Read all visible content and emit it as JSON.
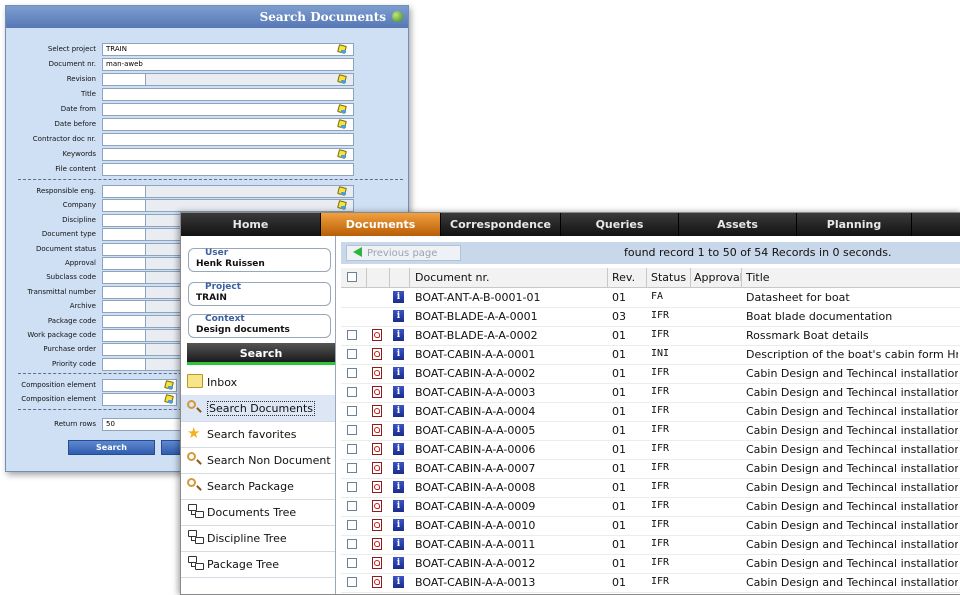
{
  "search_form": {
    "title": "Search Documents",
    "fields": [
      {
        "label": "Select project",
        "value": "TRAIN",
        "type": "picker"
      },
      {
        "label": "Document nr.",
        "value": "man-aweb",
        "type": "text"
      },
      {
        "label": "Revision",
        "value": "",
        "type": "split-picker"
      },
      {
        "label": "Title",
        "value": "",
        "type": "text"
      },
      {
        "label": "Date from",
        "value": "",
        "type": "picker"
      },
      {
        "label": "Date before",
        "value": "",
        "type": "picker"
      },
      {
        "label": "Contractor doc nr.",
        "value": "",
        "type": "text"
      },
      {
        "label": "Keywords",
        "value": "",
        "type": "picker"
      },
      {
        "label": "File content",
        "value": "",
        "type": "text"
      }
    ],
    "fields2": [
      "Responsible eng.",
      "Company",
      "Discipline",
      "Document type",
      "Document status",
      "Approval",
      "Subclass code",
      "Transmittal number",
      "Archive",
      "Package code",
      "Work package code",
      "Purchase order",
      "Priority code"
    ],
    "composition": [
      "Composition element",
      "Composition element"
    ],
    "return_rows_label": "Return rows",
    "return_rows_value": "50",
    "search_button": "Search"
  },
  "nav": {
    "tabs": [
      "Home",
      "Documents",
      "Correspondence",
      "Queries",
      "Assets",
      "Planning"
    ],
    "active": "Documents"
  },
  "sidebar": {
    "user_title": "User",
    "user_value": "Henk Ruissen",
    "project_title": "Project",
    "project_value": "TRAIN",
    "context_title": "Context",
    "context_value": "Design documents",
    "search_header": "Search",
    "items": [
      {
        "label": "Inbox",
        "icon": "folder-icon"
      },
      {
        "label": "Search Documents",
        "icon": "magnifier-icon"
      },
      {
        "label": "Search favorites",
        "icon": "star-icon"
      },
      {
        "label": "Search Non Document",
        "icon": "magnifier-icon"
      },
      {
        "label": "Search Package",
        "icon": "magnifier-icon"
      },
      {
        "label": "Documents Tree",
        "icon": "tree-icon"
      },
      {
        "label": "Discipline Tree",
        "icon": "tree-icon"
      },
      {
        "label": "Package Tree",
        "icon": "tree-icon"
      }
    ]
  },
  "results": {
    "prev_label": "Previous page",
    "found_text": "found record 1 to 50 of 54 Records in 0 seconds.",
    "columns": {
      "doc": "Document nr.",
      "rev": "Rev.",
      "status": "Status",
      "approval": "Approval",
      "title": "Title"
    },
    "rows": [
      {
        "doc": "BOAT-ANT-A-B-0001-01",
        "rev": "01",
        "status": "FA",
        "title": "Datasheet for boat",
        "checkbox": false,
        "pdf": false
      },
      {
        "doc": "BOAT-BLADE-A-A-0001",
        "rev": "03",
        "status": "IFR",
        "title": "Boat blade documentation",
        "checkbox": false,
        "pdf": false
      },
      {
        "doc": "BOAT-BLADE-A-A-0002",
        "rev": "01",
        "status": "IFR",
        "title": "Rossmark Boat details",
        "checkbox": true,
        "pdf": true
      },
      {
        "doc": "BOAT-CABIN-A-A-0001",
        "rev": "01",
        "status": "INI",
        "title": "Description of the boat's cabin form Hnek's",
        "checkbox": true,
        "pdf": true
      },
      {
        "doc": "BOAT-CABIN-A-A-0002",
        "rev": "01",
        "status": "IFR",
        "title": "Cabin Design and Techincal installations pa",
        "checkbox": true,
        "pdf": true
      },
      {
        "doc": "BOAT-CABIN-A-A-0003",
        "rev": "01",
        "status": "IFR",
        "title": "Cabin Design and Techincal installations pa",
        "checkbox": true,
        "pdf": true
      },
      {
        "doc": "BOAT-CABIN-A-A-0004",
        "rev": "01",
        "status": "IFR",
        "title": "Cabin Design and Techincal installations pa",
        "checkbox": true,
        "pdf": true
      },
      {
        "doc": "BOAT-CABIN-A-A-0005",
        "rev": "01",
        "status": "IFR",
        "title": "Cabin Design and Techincal installations pa",
        "checkbox": true,
        "pdf": true
      },
      {
        "doc": "BOAT-CABIN-A-A-0006",
        "rev": "01",
        "status": "IFR",
        "title": "Cabin Design and Techincal installations pa",
        "checkbox": true,
        "pdf": true
      },
      {
        "doc": "BOAT-CABIN-A-A-0007",
        "rev": "01",
        "status": "IFR",
        "title": "Cabin Design and Techincal installations pa",
        "checkbox": true,
        "pdf": true
      },
      {
        "doc": "BOAT-CABIN-A-A-0008",
        "rev": "01",
        "status": "IFR",
        "title": "Cabin Design and Techincal installations pa",
        "checkbox": true,
        "pdf": true
      },
      {
        "doc": "BOAT-CABIN-A-A-0009",
        "rev": "01",
        "status": "IFR",
        "title": "Cabin Design and Techincal installations pa",
        "checkbox": true,
        "pdf": true
      },
      {
        "doc": "BOAT-CABIN-A-A-0010",
        "rev": "01",
        "status": "IFR",
        "title": "Cabin Design and Techincal installations pa",
        "checkbox": true,
        "pdf": true
      },
      {
        "doc": "BOAT-CABIN-A-A-0011",
        "rev": "01",
        "status": "IFR",
        "title": "Cabin Design and Techincal installations pa",
        "checkbox": true,
        "pdf": true
      },
      {
        "doc": "BOAT-CABIN-A-A-0012",
        "rev": "01",
        "status": "IFR",
        "title": "Cabin Design and Techincal installations pa",
        "checkbox": true,
        "pdf": true
      },
      {
        "doc": "BOAT-CABIN-A-A-0013",
        "rev": "01",
        "status": "IFR",
        "title": "Cabin Design and Techincal installations pa",
        "checkbox": true,
        "pdf": true
      }
    ]
  },
  "colors": {
    "accent": "#e8892a",
    "header_blue": "#5677b4",
    "result_head": "#c9d7ea"
  }
}
